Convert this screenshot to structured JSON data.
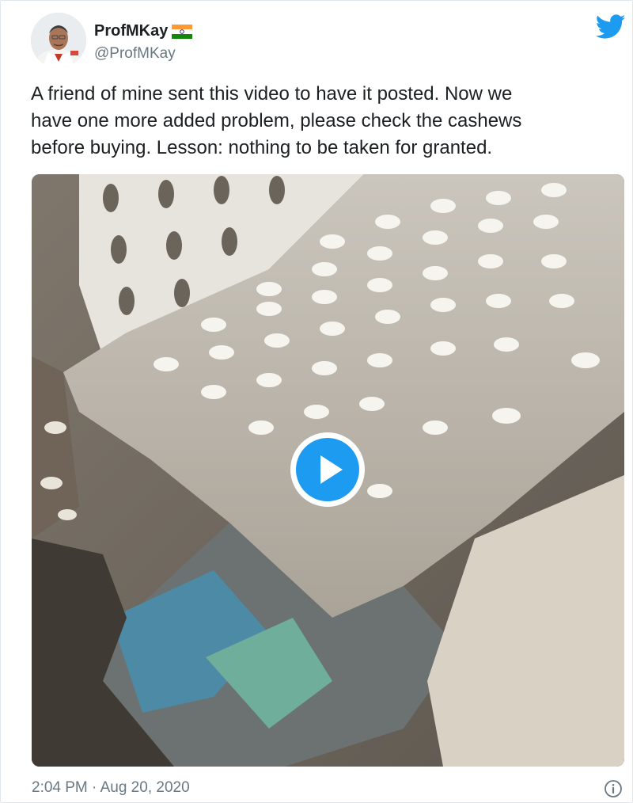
{
  "tweet": {
    "author": {
      "display_name": "ProfMKay",
      "handle": "@ProfMKay",
      "flag_icon": "india-flag-icon",
      "avatar_icon": "profile-avatar"
    },
    "brand_icon": "twitter-bird-icon",
    "text_lines": [
      "A friend of mine sent this video to have it posted. Now we",
      "have one more added problem, please check the cashews",
      "before buying. Lesson: nothing to be taken for granted."
    ],
    "media": {
      "type": "video",
      "play_icon": "play-icon"
    },
    "timestamp": "2:04 PM · Aug 20, 2020",
    "info_icon": "info-icon"
  },
  "colors": {
    "twitter_blue": "#1d9bf0",
    "name_text": "#1c2022",
    "secondary_text": "#697882",
    "border": "#e1e8ed"
  }
}
